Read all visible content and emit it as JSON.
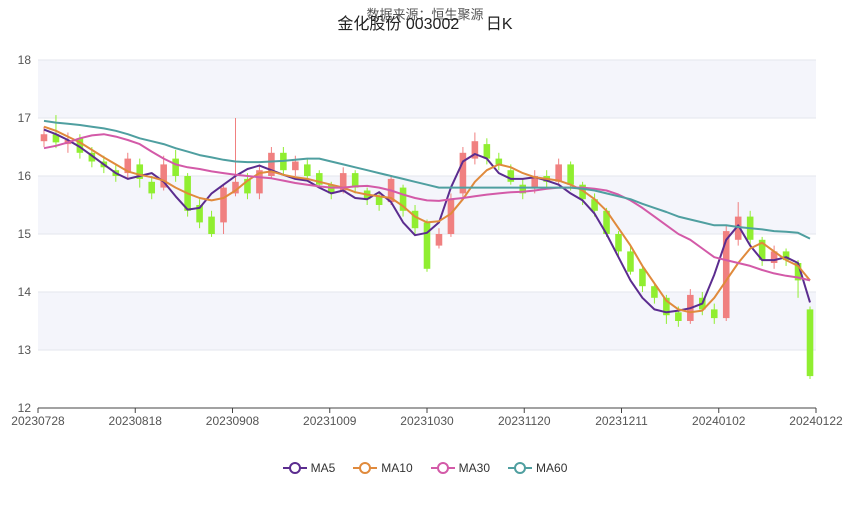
{
  "header": {
    "source": "数据来源：恒生聚源",
    "title": "金化股份 003002      日K"
  },
  "colors": {
    "up": "#f08080",
    "down": "#90ee30",
    "MA5": "#5b2c8f",
    "MA10": "#e08a3c",
    "MA30": "#d35aa8",
    "MA60": "#4f9fa0",
    "band": "#f4f5fb"
  },
  "chart_data": {
    "type": "candlestick",
    "ylim": [
      12,
      18
    ],
    "y_ticks": [
      "12",
      "13",
      "14",
      "15",
      "16",
      "17",
      "18"
    ],
    "x_tick_labels": [
      "20230728",
      "20230818",
      "20230908",
      "20231009",
      "20231030",
      "20231120",
      "20231211",
      "20240102",
      "20240122"
    ],
    "series": [
      {
        "name": "MA5",
        "values": [
          16.8,
          16.72,
          16.62,
          16.5,
          16.35,
          16.2,
          16.05,
          15.95,
          16.0,
          16.05,
          15.9,
          15.65,
          15.42,
          15.45,
          15.7,
          15.85,
          16.0,
          16.12,
          16.18,
          16.1,
          16.02,
          15.95,
          15.92,
          15.8,
          15.7,
          15.75,
          15.62,
          15.6,
          15.72,
          15.55,
          15.2,
          14.98,
          15.02,
          15.2,
          15.8,
          16.25,
          16.38,
          16.3,
          16.05,
          15.95,
          15.95,
          15.98,
          15.92,
          15.85,
          15.7,
          15.58,
          15.35,
          15.0,
          14.6,
          14.2,
          13.9,
          13.7,
          13.65,
          13.68,
          13.72,
          13.8,
          14.3,
          14.9,
          15.15,
          14.8,
          14.55,
          14.55,
          14.6,
          14.5,
          13.82
        ]
      },
      {
        "name": "MA10",
        "values": [
          16.85,
          16.78,
          16.68,
          16.58,
          16.45,
          16.32,
          16.2,
          16.08,
          16.02,
          15.98,
          15.92,
          15.8,
          15.7,
          15.62,
          15.58,
          15.62,
          15.75,
          15.92,
          16.05,
          16.08,
          16.02,
          15.98,
          15.95,
          15.9,
          15.85,
          15.8,
          15.72,
          15.68,
          15.65,
          15.62,
          15.48,
          15.3,
          15.2,
          15.22,
          15.35,
          15.6,
          15.9,
          16.1,
          16.2,
          16.15,
          16.05,
          15.98,
          15.95,
          15.92,
          15.85,
          15.75,
          15.6,
          15.4,
          15.1,
          14.8,
          14.45,
          14.15,
          13.85,
          13.7,
          13.65,
          13.68,
          13.9,
          14.2,
          14.5,
          14.75,
          14.85,
          14.7,
          14.55,
          14.45,
          14.2
        ]
      },
      {
        "name": "MA30",
        "values": [
          16.48,
          16.52,
          16.58,
          16.65,
          16.7,
          16.72,
          16.68,
          16.62,
          16.55,
          16.42,
          16.3,
          16.2,
          16.15,
          16.12,
          16.08,
          16.05,
          16.02,
          16.0,
          15.98,
          15.96,
          15.92,
          15.88,
          15.85,
          15.82,
          15.8,
          15.8,
          15.82,
          15.83,
          15.8,
          15.75,
          15.68,
          15.62,
          15.58,
          15.57,
          15.6,
          15.62,
          15.65,
          15.68,
          15.7,
          15.72,
          15.73,
          15.75,
          15.78,
          15.8,
          15.8,
          15.8,
          15.78,
          15.75,
          15.68,
          15.58,
          15.45,
          15.3,
          15.15,
          15.0,
          14.9,
          14.75,
          14.6,
          14.55,
          14.5,
          14.45,
          14.38,
          14.32,
          14.28,
          14.25,
          14.2
        ]
      },
      {
        "name": "MA60",
        "values": [
          16.95,
          16.92,
          16.9,
          16.88,
          16.85,
          16.82,
          16.78,
          16.72,
          16.65,
          16.6,
          16.55,
          16.48,
          16.42,
          16.36,
          16.32,
          16.28,
          16.25,
          16.24,
          16.24,
          16.25,
          16.26,
          16.28,
          16.3,
          16.3,
          16.25,
          16.2,
          16.15,
          16.1,
          16.05,
          16.0,
          15.95,
          15.9,
          15.85,
          15.8,
          15.8,
          15.8,
          15.8,
          15.8,
          15.8,
          15.8,
          15.8,
          15.8,
          15.8,
          15.8,
          15.8,
          15.78,
          15.75,
          15.7,
          15.65,
          15.6,
          15.52,
          15.45,
          15.38,
          15.3,
          15.25,
          15.2,
          15.15,
          15.15,
          15.12,
          15.1,
          15.08,
          15.05,
          15.04,
          15.02,
          14.92
        ]
      }
    ],
    "candles": [
      {
        "o": 16.6,
        "c": 16.72,
        "h": 16.85,
        "l": 16.5
      },
      {
        "o": 16.72,
        "c": 16.58,
        "h": 17.05,
        "l": 16.48
      },
      {
        "o": 16.55,
        "c": 16.62,
        "h": 16.75,
        "l": 16.4
      },
      {
        "o": 16.65,
        "c": 16.4,
        "h": 16.72,
        "l": 16.3
      },
      {
        "o": 16.4,
        "c": 16.25,
        "h": 16.5,
        "l": 16.15
      },
      {
        "o": 16.25,
        "c": 16.15,
        "h": 16.35,
        "l": 16.05
      },
      {
        "o": 16.1,
        "c": 16.0,
        "h": 16.2,
        "l": 15.9
      },
      {
        "o": 16.05,
        "c": 16.3,
        "h": 16.4,
        "l": 15.95
      },
      {
        "o": 16.2,
        "c": 15.95,
        "h": 16.3,
        "l": 15.8
      },
      {
        "o": 15.9,
        "c": 15.7,
        "h": 16.0,
        "l": 15.6
      },
      {
        "o": 15.8,
        "c": 16.2,
        "h": 16.35,
        "l": 15.75
      },
      {
        "o": 16.3,
        "c": 16.0,
        "h": 16.45,
        "l": 15.9
      },
      {
        "o": 16.0,
        "c": 15.4,
        "h": 16.05,
        "l": 15.3
      },
      {
        "o": 15.5,
        "c": 15.2,
        "h": 15.6,
        "l": 15.1
      },
      {
        "o": 15.3,
        "c": 15.0,
        "h": 15.4,
        "l": 14.95
      },
      {
        "o": 15.2,
        "c": 15.8,
        "h": 15.85,
        "l": 15.0
      },
      {
        "o": 15.7,
        "c": 15.9,
        "h": 17.0,
        "l": 15.65
      },
      {
        "o": 15.95,
        "c": 15.7,
        "h": 16.05,
        "l": 15.6
      },
      {
        "o": 15.7,
        "c": 16.1,
        "h": 16.2,
        "l": 15.6
      },
      {
        "o": 16.0,
        "c": 16.4,
        "h": 16.5,
        "l": 15.95
      },
      {
        "o": 16.4,
        "c": 16.1,
        "h": 16.5,
        "l": 16.0
      },
      {
        "o": 16.1,
        "c": 16.25,
        "h": 16.35,
        "l": 16.0
      },
      {
        "o": 16.2,
        "c": 16.0,
        "h": 16.3,
        "l": 15.95
      },
      {
        "o": 16.05,
        "c": 15.85,
        "h": 16.1,
        "l": 15.8
      },
      {
        "o": 15.85,
        "c": 15.7,
        "h": 15.9,
        "l": 15.6
      },
      {
        "o": 15.75,
        "c": 16.05,
        "h": 16.15,
        "l": 15.7
      },
      {
        "o": 16.05,
        "c": 15.8,
        "h": 16.1,
        "l": 15.7
      },
      {
        "o": 15.75,
        "c": 15.6,
        "h": 15.8,
        "l": 15.5
      },
      {
        "o": 15.65,
        "c": 15.5,
        "h": 15.7,
        "l": 15.4
      },
      {
        "o": 15.55,
        "c": 15.95,
        "h": 16.0,
        "l": 15.5
      },
      {
        "o": 15.8,
        "c": 15.4,
        "h": 15.85,
        "l": 15.3
      },
      {
        "o": 15.4,
        "c": 15.1,
        "h": 15.5,
        "l": 15.0
      },
      {
        "o": 15.2,
        "c": 14.4,
        "h": 15.25,
        "l": 14.35
      },
      {
        "o": 14.8,
        "c": 15.0,
        "h": 15.1,
        "l": 14.75
      },
      {
        "o": 15.0,
        "c": 15.6,
        "h": 15.7,
        "l": 14.95
      },
      {
        "o": 15.7,
        "c": 16.4,
        "h": 16.5,
        "l": 15.6
      },
      {
        "o": 16.3,
        "c": 16.6,
        "h": 16.75,
        "l": 16.2
      },
      {
        "o": 16.55,
        "c": 16.3,
        "h": 16.65,
        "l": 16.2
      },
      {
        "o": 16.3,
        "c": 16.2,
        "h": 16.4,
        "l": 16.1
      },
      {
        "o": 16.1,
        "c": 15.9,
        "h": 16.2,
        "l": 15.85
      },
      {
        "o": 15.85,
        "c": 15.7,
        "h": 15.95,
        "l": 15.6
      },
      {
        "o": 15.8,
        "c": 16.0,
        "h": 16.1,
        "l": 15.7
      },
      {
        "o": 16.0,
        "c": 15.9,
        "h": 16.1,
        "l": 15.8
      },
      {
        "o": 15.9,
        "c": 16.2,
        "h": 16.3,
        "l": 15.85
      },
      {
        "o": 16.2,
        "c": 15.85,
        "h": 16.25,
        "l": 15.75
      },
      {
        "o": 15.85,
        "c": 15.6,
        "h": 15.9,
        "l": 15.5
      },
      {
        "o": 15.6,
        "c": 15.4,
        "h": 15.7,
        "l": 15.3
      },
      {
        "o": 15.4,
        "c": 15.0,
        "h": 15.45,
        "l": 14.95
      },
      {
        "o": 15.0,
        "c": 14.7,
        "h": 15.05,
        "l": 14.6
      },
      {
        "o": 14.7,
        "c": 14.35,
        "h": 14.8,
        "l": 14.3
      },
      {
        "o": 14.4,
        "c": 14.1,
        "h": 14.45,
        "l": 14.0
      },
      {
        "o": 14.1,
        "c": 13.9,
        "h": 14.15,
        "l": 13.8
      },
      {
        "o": 13.9,
        "c": 13.6,
        "h": 13.95,
        "l": 13.45
      },
      {
        "o": 13.65,
        "c": 13.5,
        "h": 13.75,
        "l": 13.4
      },
      {
        "o": 13.5,
        "c": 13.95,
        "h": 14.05,
        "l": 13.45
      },
      {
        "o": 13.9,
        "c": 13.7,
        "h": 14.0,
        "l": 13.6
      },
      {
        "o": 13.7,
        "c": 13.55,
        "h": 13.8,
        "l": 13.45
      },
      {
        "o": 13.55,
        "c": 15.05,
        "h": 15.15,
        "l": 13.5
      },
      {
        "o": 14.9,
        "c": 15.3,
        "h": 15.55,
        "l": 14.8
      },
      {
        "o": 15.3,
        "c": 14.9,
        "h": 15.4,
        "l": 14.8
      },
      {
        "o": 14.9,
        "c": 14.55,
        "h": 14.95,
        "l": 14.45
      },
      {
        "o": 14.5,
        "c": 14.7,
        "h": 14.8,
        "l": 14.4
      },
      {
        "o": 14.7,
        "c": 14.55,
        "h": 14.75,
        "l": 14.45
      },
      {
        "o": 14.5,
        "c": 14.2,
        "h": 14.55,
        "l": 13.9
      },
      {
        "o": 13.7,
        "c": 12.55,
        "h": 13.75,
        "l": 12.5
      }
    ]
  },
  "legend": [
    {
      "name": "MA5",
      "color_key": "MA5"
    },
    {
      "name": "MA10",
      "color_key": "MA10"
    },
    {
      "name": "MA30",
      "color_key": "MA30"
    },
    {
      "name": "MA60",
      "color_key": "MA60"
    }
  ]
}
